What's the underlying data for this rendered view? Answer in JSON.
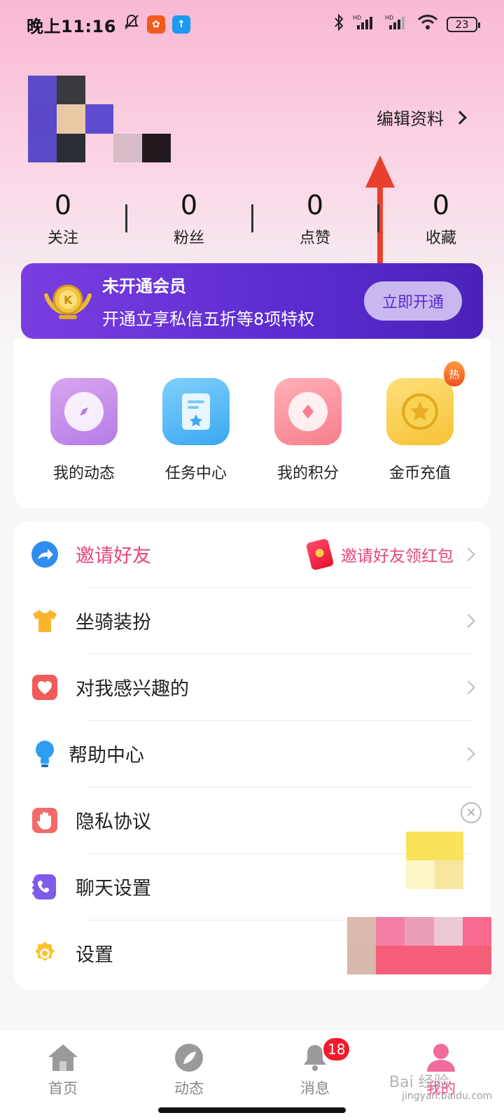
{
  "status_bar": {
    "time": "晚上11:16",
    "battery": "23",
    "network_label": "HD"
  },
  "profile": {
    "edit_label": "编辑资料"
  },
  "stats": [
    {
      "value": "0",
      "label": "关注"
    },
    {
      "value": "0",
      "label": "粉丝"
    },
    {
      "value": "0",
      "label": "点赞"
    },
    {
      "value": "0",
      "label": "收藏"
    }
  ],
  "vip": {
    "title": "未开通会员",
    "desc": "开通立享私信五折等8项特权",
    "button": "立即开通"
  },
  "quick_actions": [
    {
      "label": "我的动态",
      "icon": "compass-icon"
    },
    {
      "label": "任务中心",
      "icon": "task-card-icon"
    },
    {
      "label": "我的积分",
      "icon": "points-icon"
    },
    {
      "label": "金币充值",
      "icon": "gold-coin-icon",
      "badge": "热"
    }
  ],
  "menu": [
    {
      "label": "邀请好友",
      "icon": "share-arrow-icon",
      "right_text": "邀请好友领红包"
    },
    {
      "label": "坐骑装扮",
      "icon": "tshirt-icon"
    },
    {
      "label": "对我感兴趣的",
      "icon": "heart-icon"
    },
    {
      "label": "帮助中心",
      "icon": "lightbulb-icon"
    },
    {
      "label": "隐私协议",
      "icon": "hand-icon"
    },
    {
      "label": "聊天设置",
      "icon": "phone-chat-icon"
    },
    {
      "label": "设置",
      "icon": "gear-icon"
    }
  ],
  "tabbar": [
    {
      "label": "首页",
      "icon": "home-icon"
    },
    {
      "label": "动态",
      "icon": "leaf-icon"
    },
    {
      "label": "消息",
      "icon": "bell-icon",
      "badge": "18"
    },
    {
      "label": "我的",
      "icon": "user-icon"
    }
  ],
  "watermark": {
    "text": "Bai 经验",
    "sub": "jingyan.baidu.com"
  },
  "colors": {
    "accent_pink": "#f0458d",
    "vip_purple": "#5b2bd0",
    "annotation_arrow": "#e8402c"
  }
}
